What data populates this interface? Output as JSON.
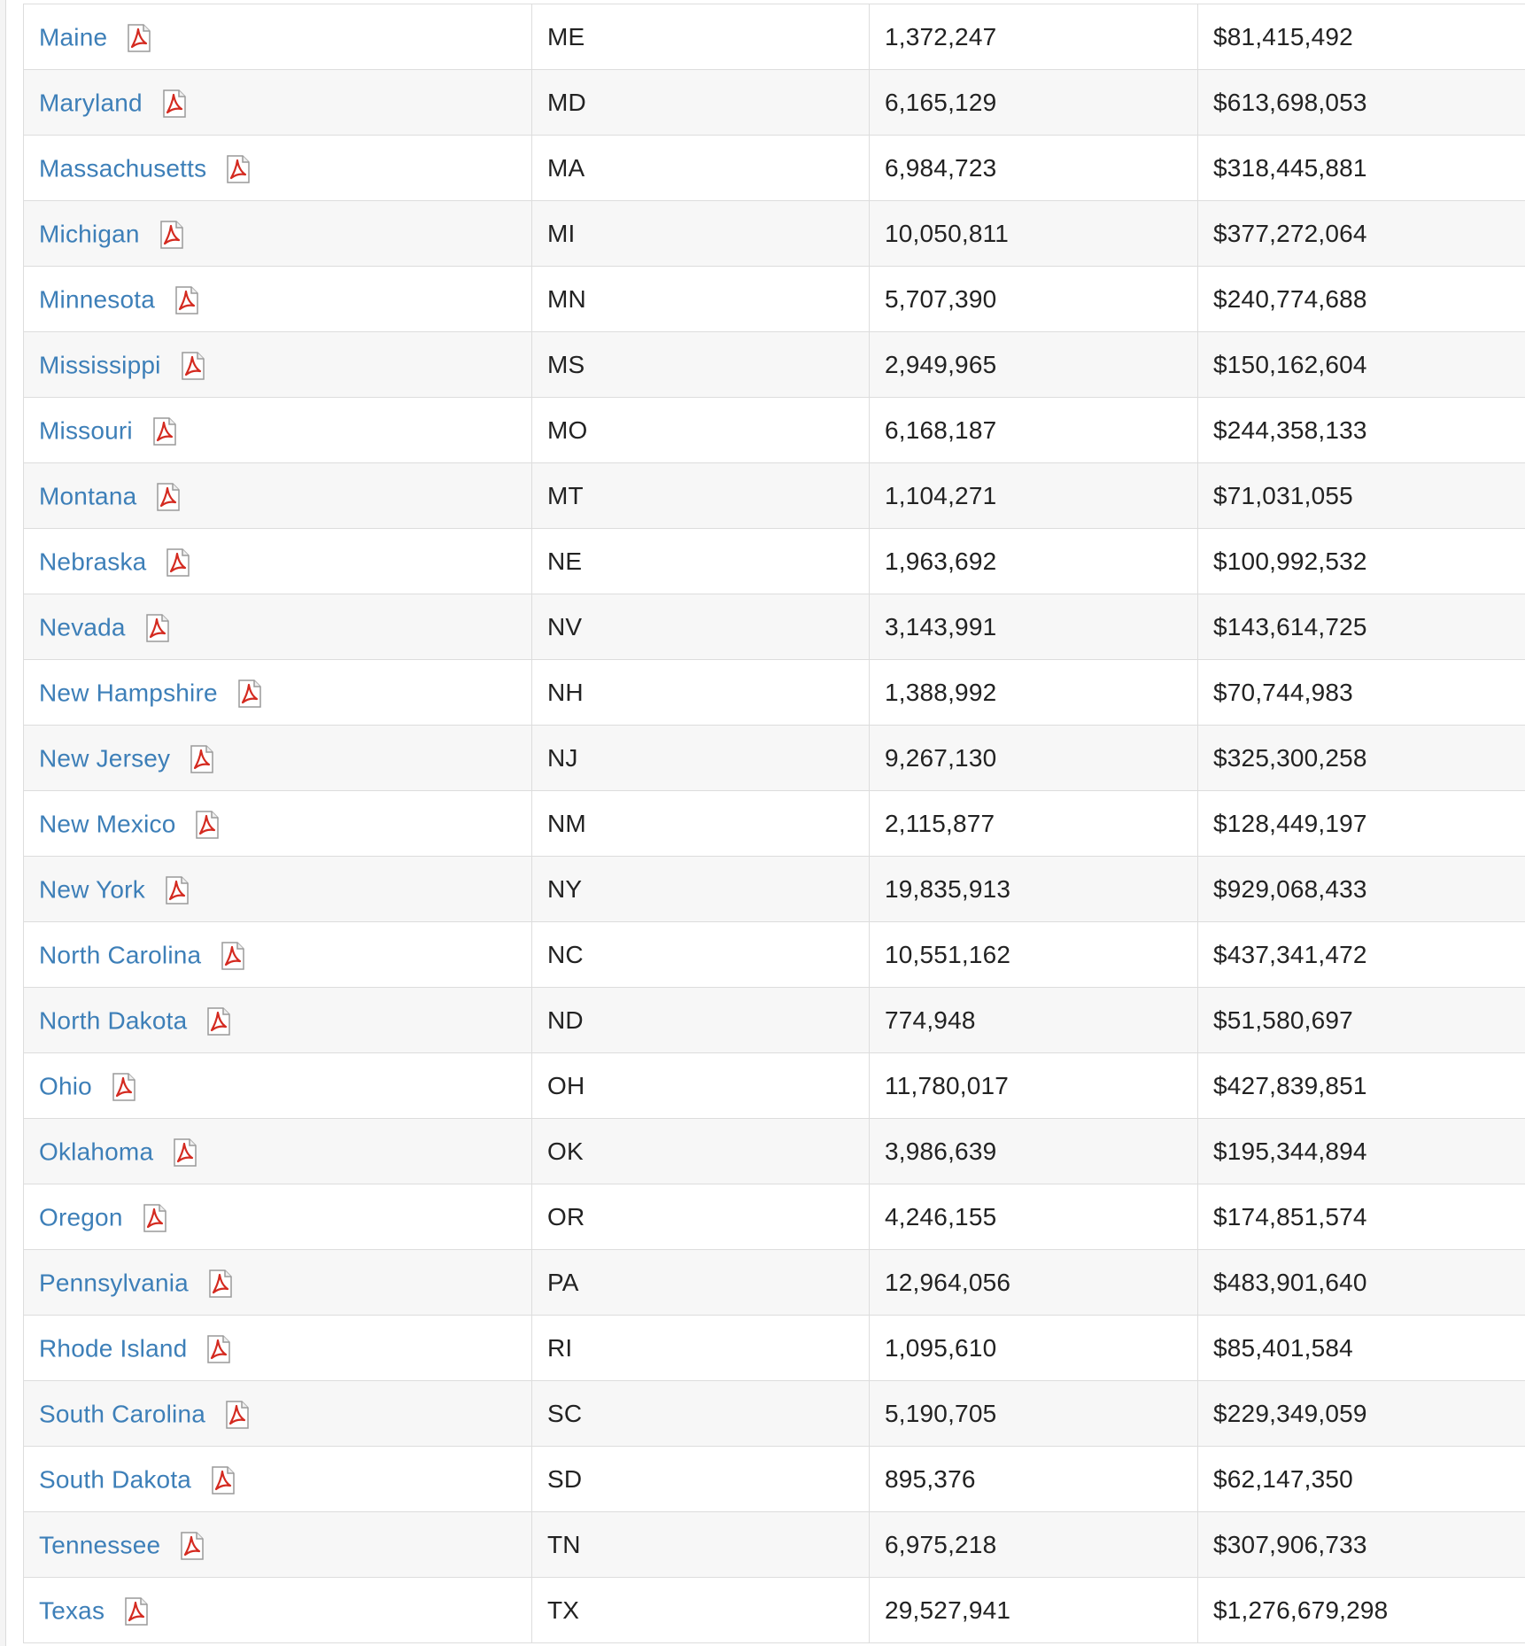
{
  "table": {
    "rows": [
      {
        "state": "Maine",
        "abbr": "ME",
        "population": "1,372,247",
        "amount": "$81,415,492"
      },
      {
        "state": "Maryland",
        "abbr": "MD",
        "population": "6,165,129",
        "amount": "$613,698,053"
      },
      {
        "state": "Massachusetts",
        "abbr": "MA",
        "population": "6,984,723",
        "amount": "$318,445,881"
      },
      {
        "state": "Michigan",
        "abbr": "MI",
        "population": "10,050,811",
        "amount": "$377,272,064"
      },
      {
        "state": "Minnesota",
        "abbr": "MN",
        "population": "5,707,390",
        "amount": "$240,774,688"
      },
      {
        "state": "Mississippi",
        "abbr": "MS",
        "population": "2,949,965",
        "amount": "$150,162,604"
      },
      {
        "state": "Missouri",
        "abbr": "MO",
        "population": "6,168,187",
        "amount": "$244,358,133"
      },
      {
        "state": "Montana",
        "abbr": "MT",
        "population": "1,104,271",
        "amount": "$71,031,055"
      },
      {
        "state": "Nebraska",
        "abbr": "NE",
        "population": "1,963,692",
        "amount": "$100,992,532"
      },
      {
        "state": "Nevada",
        "abbr": "NV",
        "population": "3,143,991",
        "amount": "$143,614,725"
      },
      {
        "state": "New Hampshire",
        "abbr": "NH",
        "population": "1,388,992",
        "amount": "$70,744,983"
      },
      {
        "state": "New Jersey",
        "abbr": "NJ",
        "population": "9,267,130",
        "amount": "$325,300,258"
      },
      {
        "state": "New Mexico",
        "abbr": "NM",
        "population": "2,115,877",
        "amount": "$128,449,197"
      },
      {
        "state": "New York",
        "abbr": "NY",
        "population": "19,835,913",
        "amount": "$929,068,433"
      },
      {
        "state": "North Carolina",
        "abbr": "NC",
        "population": "10,551,162",
        "amount": "$437,341,472"
      },
      {
        "state": "North Dakota",
        "abbr": "ND",
        "population": "774,948",
        "amount": "$51,580,697"
      },
      {
        "state": "Ohio",
        "abbr": "OH",
        "population": "11,780,017",
        "amount": "$427,839,851"
      },
      {
        "state": "Oklahoma",
        "abbr": "OK",
        "population": "3,986,639",
        "amount": "$195,344,894"
      },
      {
        "state": "Oregon",
        "abbr": "OR",
        "population": "4,246,155",
        "amount": "$174,851,574"
      },
      {
        "state": "Pennsylvania",
        "abbr": "PA",
        "population": "12,964,056",
        "amount": "$483,901,640"
      },
      {
        "state": "Rhode Island",
        "abbr": "RI",
        "population": "1,095,610",
        "amount": "$85,401,584"
      },
      {
        "state": "South Carolina",
        "abbr": "SC",
        "population": "5,190,705",
        "amount": "$229,349,059"
      },
      {
        "state": "South Dakota",
        "abbr": "SD",
        "population": "895,376",
        "amount": "$62,147,350"
      },
      {
        "state": "Tennessee",
        "abbr": "TN",
        "population": "6,975,218",
        "amount": "$307,906,733"
      },
      {
        "state": "Texas",
        "abbr": "TX",
        "population": "29,527,941",
        "amount": "$1,276,679,298"
      }
    ],
    "icon": "pdf-icon"
  },
  "colors": {
    "link": "#3d7fb8",
    "text": "#222222",
    "stripe": "#f7f7f7",
    "border": "#dddddd",
    "pdf_red": "#d42a20"
  }
}
